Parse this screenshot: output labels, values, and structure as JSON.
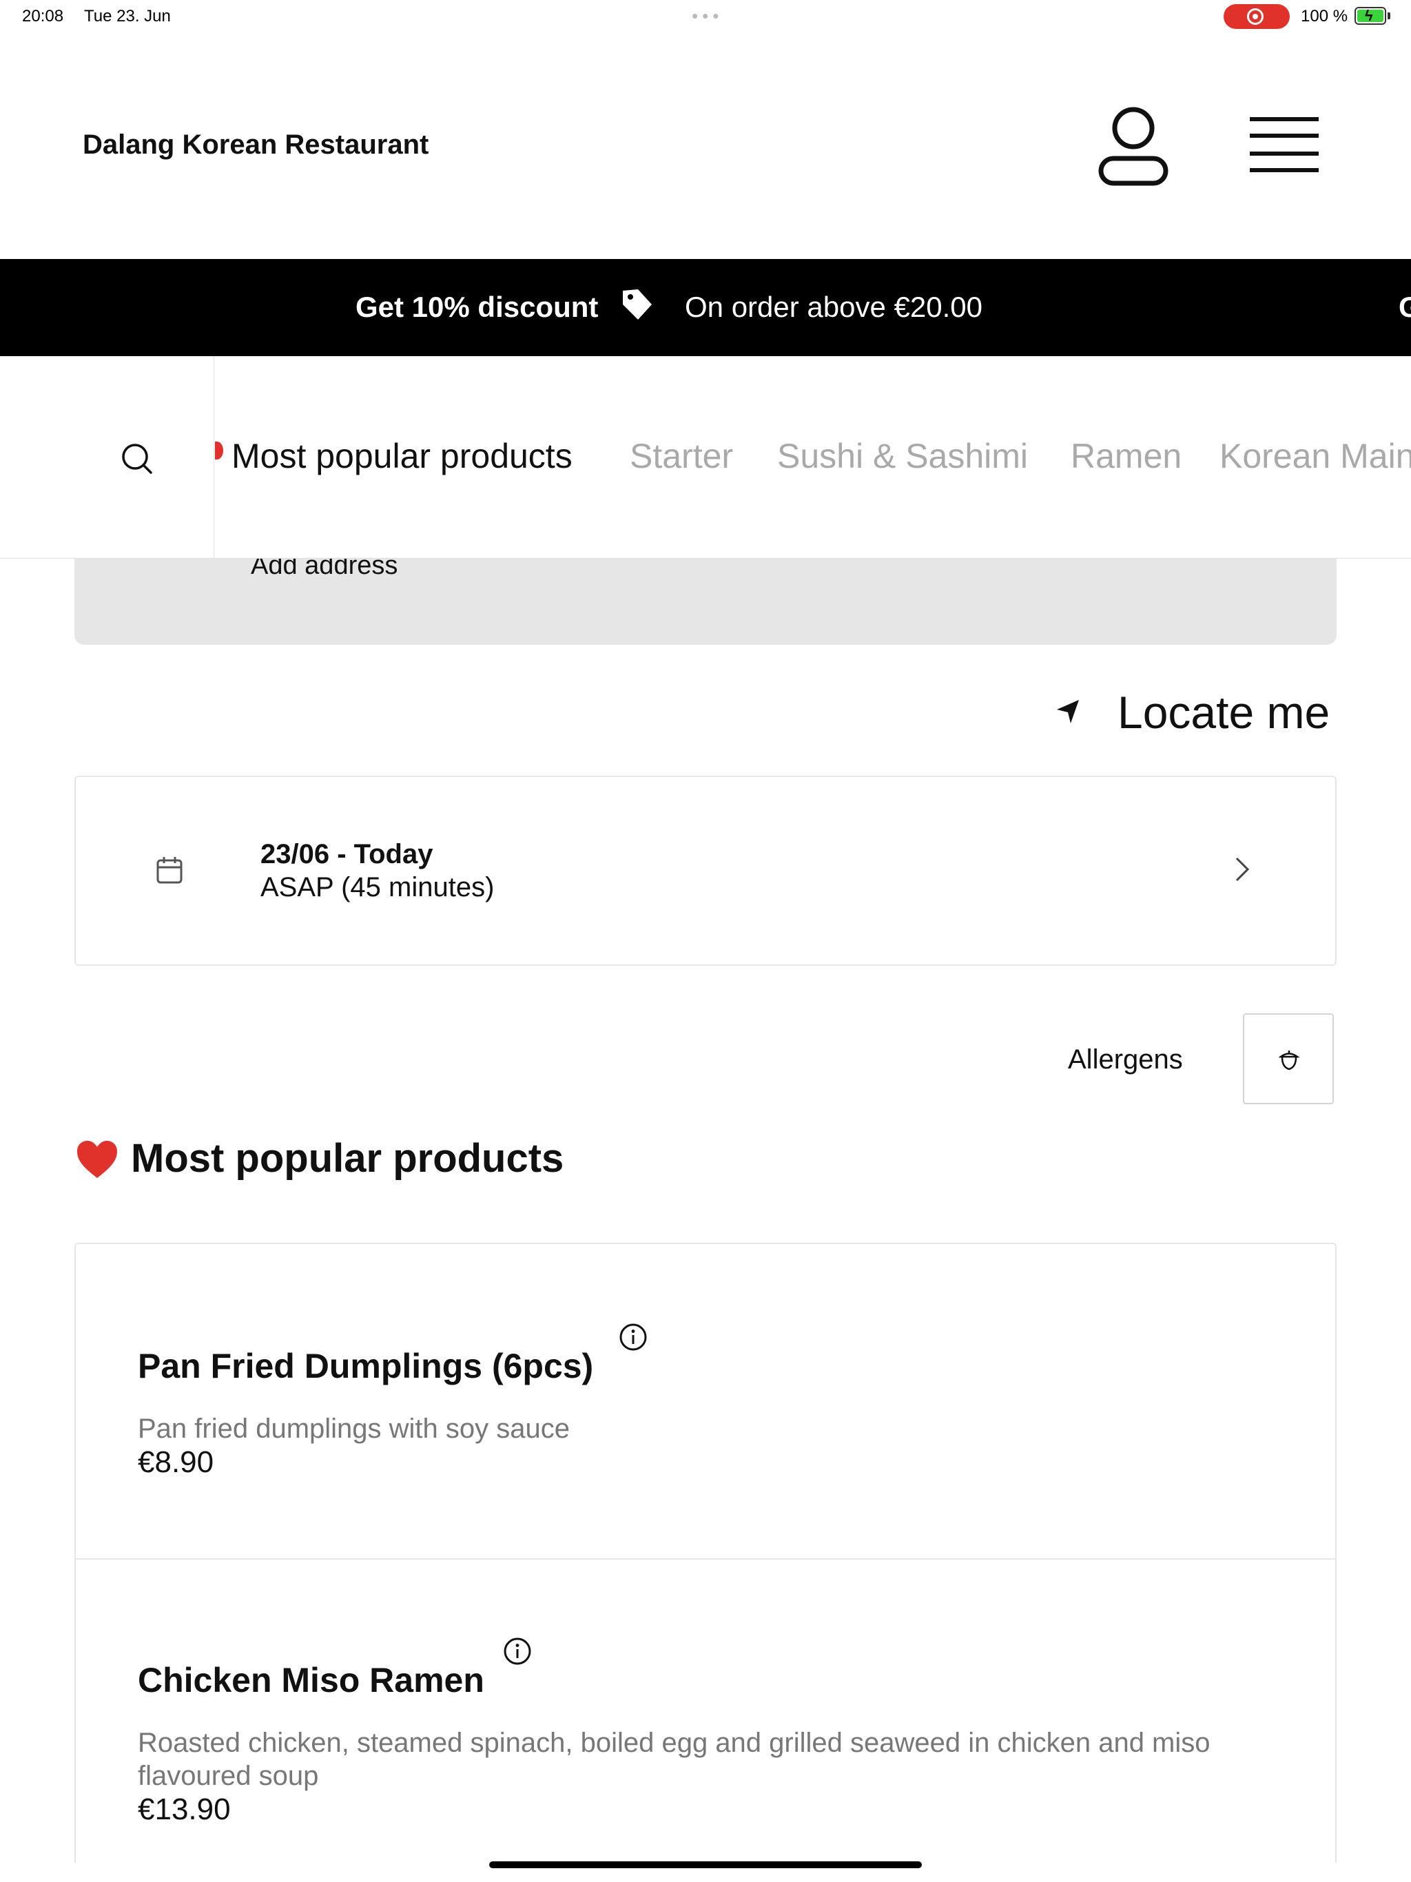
{
  "status_bar": {
    "time": "20:08",
    "date": "Tue 23. Jun",
    "battery": "100 %"
  },
  "header": {
    "restaurant_name": "Dalang Korean Restaurant",
    "account_icon": "user-icon",
    "menu_icon": "hamburger-menu-icon"
  },
  "promo": {
    "title": "Get 10% discount",
    "tag_icon": "price-tag-icon",
    "subtitle": "On order above €20.00",
    "next_partial": "G"
  },
  "category_nav": {
    "search_icon": "search-icon",
    "items": [
      {
        "label": "Most popular products",
        "active": true
      },
      {
        "label": "Starter",
        "active": false
      },
      {
        "label": "Sushi & Sashimi",
        "active": false
      },
      {
        "label": "Ramen",
        "active": false
      },
      {
        "label": "Korean Main",
        "active": false
      }
    ]
  },
  "address": {
    "label": "Add address"
  },
  "locate": {
    "label": "Locate me",
    "icon": "location-arrow-icon"
  },
  "time_slot": {
    "date": "23/06 - Today",
    "time": "ASAP (45 minutes)",
    "icon": "calendar-icon"
  },
  "allergens": {
    "label": "Allergens",
    "icon": "acorn-icon"
  },
  "section": {
    "emoji_icon": "heart-icon",
    "title": "Most popular products"
  },
  "products": [
    {
      "name": "Pan Fried Dumplings (6pcs)",
      "description": "Pan fried dumplings with soy sauce",
      "price": "€8.90"
    },
    {
      "name": "Chicken Miso Ramen",
      "description": "Roasted chicken, steamed spinach, boiled egg and grilled seaweed in chicken and miso flavoured soup",
      "price": "€13.90"
    }
  ],
  "colors": {
    "accent_red": "#e0312a",
    "banner_bg": "#000000",
    "inactive_tab": "#a9a9a9",
    "muted_text": "#777777"
  }
}
